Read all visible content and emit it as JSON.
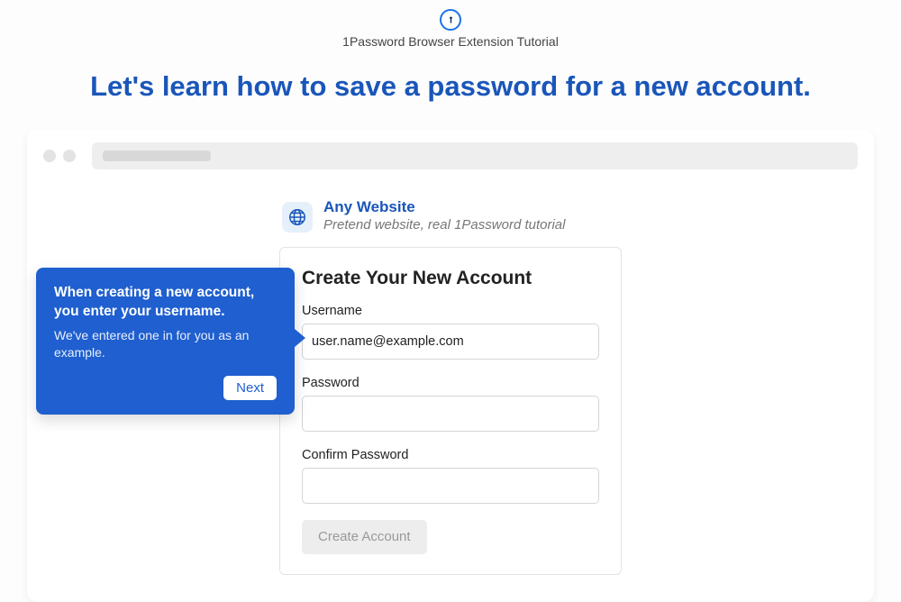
{
  "header": {
    "tutorial_label": "1Password Browser Extension Tutorial",
    "headline": "Let's learn how to save a password for a new account."
  },
  "site": {
    "name": "Any Website",
    "subtitle": "Pretend website, real 1Password tutorial"
  },
  "form": {
    "title": "Create Your New Account",
    "username_label": "Username",
    "username_value": "user.name@example.com",
    "password_label": "Password",
    "password_value": "",
    "confirm_label": "Confirm Password",
    "confirm_value": "",
    "submit_label": "Create Account"
  },
  "tooltip": {
    "title": "When creating a new account, you enter your username.",
    "body": "We've entered one in for you as an example.",
    "next_label": "Next"
  }
}
